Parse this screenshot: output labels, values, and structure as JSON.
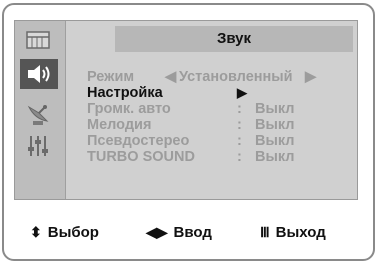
{
  "header": {
    "title": "Звук"
  },
  "sidebar": {
    "items": [
      {
        "icon": "picture-icon"
      },
      {
        "icon": "speaker-icon"
      },
      {
        "icon": "antenna-icon"
      },
      {
        "icon": "settings-sliders-icon"
      }
    ],
    "active_index": 1
  },
  "menu": {
    "mode": {
      "label": "Режим",
      "arrow_left": "◀",
      "value": "Установленный",
      "arrow_right": "▶"
    },
    "setup": {
      "label": "Настройка",
      "arrow": "▶"
    },
    "rows": [
      {
        "label": "Громк. авто",
        "colon": ":",
        "value": "Выкл"
      },
      {
        "label": "Мелодия",
        "colon": ":",
        "value": "Выкл"
      },
      {
        "label": "Псевдостерео",
        "colon": ":",
        "value": "Выкл"
      },
      {
        "label": "TURBO SOUND",
        "colon": ":",
        "value": "Выкл"
      }
    ]
  },
  "footer": {
    "select": {
      "glyph": "⬍",
      "label": "Выбор"
    },
    "enter": {
      "glyph": "◀▶",
      "label": "Ввод"
    },
    "exit": {
      "glyph": "Ⅲ",
      "label": "Выход"
    }
  }
}
